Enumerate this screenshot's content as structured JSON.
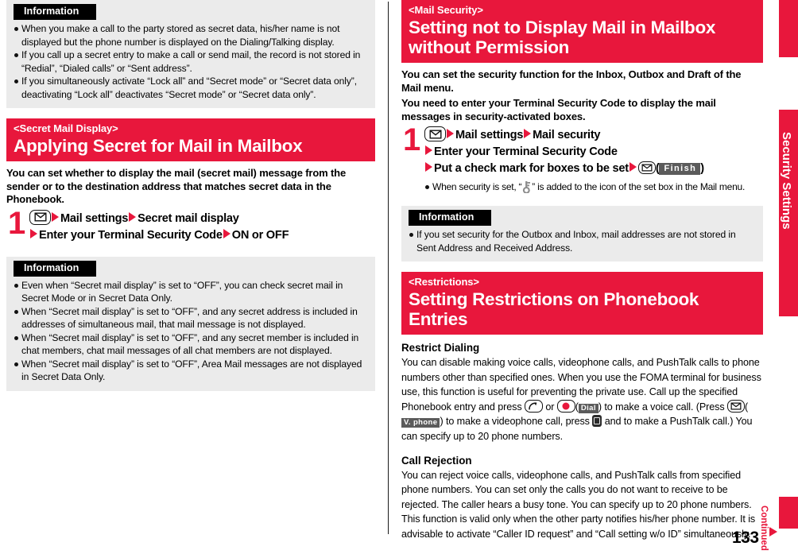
{
  "page": {
    "number": "133",
    "continued_label": "Continued",
    "tab_label": "Security Settings",
    "accent_color": "#e8173c",
    "info_panel_bg": "#ebebeb",
    "softkey_bg": "#5b5b5b"
  },
  "left_column": {
    "info_top": {
      "label": "Information",
      "bullets": [
        "When you make a call to the party stored as secret data, his/her name is not displayed but the phone number is displayed on the Dialing/Talking display.",
        "If you call up a secret entry to make a call or send mail, the record is not stored in “Redial”, “Dialed calls” or “Sent address”.",
        "If you simultaneously activate “Lock all” and “Secret mode” or “Secret data only”, deactivating “Lock all” deactivates “Secret mode” or “Secret data only”."
      ]
    },
    "section": {
      "kicker": "<Secret Mail Display>",
      "title": "Applying Secret for Mail in Mailbox",
      "lead": "You can set whether to display the mail (secret mail) message from the sender or to the destination address that matches secret data in the Phonebook."
    },
    "step": {
      "number": "1",
      "mail_icon": "mail-key-icon",
      "line1_a": "Mail settings",
      "line1_b": "Secret mail display",
      "line2_a": "Enter your Terminal Security Code",
      "line2_b": "ON or OFF"
    },
    "info_bottom": {
      "label": "Information",
      "bullets": [
        "Even when “Secret mail display” is set to “OFF”, you can check secret mail in Secret Mode or in Secret Data Only.",
        "When “Secret mail display” is set to “OFF”, and any secret address is included in addresses of simultaneous mail, that mail message is not displayed.",
        "When “Secret mail display” is set to “OFF”, and any secret member is included in chat members, chat mail messages of all chat members are not displayed.",
        "When “Secret mail display” is set to “OFF”, Area Mail messages are not displayed in Secret Data Only."
      ]
    }
  },
  "right_column": {
    "section_mail_security": {
      "kicker": "<Mail Security>",
      "title": "Setting not to Display Mail in Mailbox without Permission",
      "lead_line1": "You can set the security function for the Inbox, Outbox and Draft of the Mail menu.",
      "lead_line2": "You need to enter your Terminal Security Code to display the mail messages in security-activated boxes."
    },
    "step": {
      "number": "1",
      "mail_icon": "mail-key-icon",
      "line1_a": "Mail settings",
      "line1_b": "Mail security",
      "line2": "Enter your Terminal Security Code",
      "line3": "Put a check mark for boxes to be set",
      "finish_softkey": "Finish",
      "note_before": "When security is set, “",
      "note_icon": "key-icon",
      "note_after": "” is added to the icon of the set box in the Mail menu."
    },
    "info": {
      "label": "Information",
      "bullets": [
        "If you set security for the Outbox and Inbox, mail addresses are not stored in Sent Address and Received Address."
      ]
    },
    "section_restrictions": {
      "kicker": "<Restrictions>",
      "title": "Setting Restrictions on Phonebook Entries"
    },
    "restrict_dialing": {
      "heading": "Restrict Dialing",
      "text_p1": "You can disable making voice calls, videophone calls, and PushTalk calls to phone numbers other than specified ones. When you use the FOMA terminal for business use, this function is useful for preventing the private use. Call up the specified Phonebook entry and press",
      "phone_icon": "phone-key-icon",
      "text_or": "or",
      "circle_icon": "center-key-icon",
      "dial_softkey": "Dial",
      "text_p2": ") to make a voice call. (Press",
      "mail_icon": "mail-key-icon",
      "vphone_softkey": "V. phone",
      "text_p3": ") to make a videophone call, press",
      "pushtalk_icon": "pushtalk-key-icon",
      "text_p4": "and to make a PushTalk call.) You can specify up to 20 phone numbers."
    },
    "call_rejection": {
      "heading": "Call Rejection",
      "text": "You can reject voice calls, videophone calls, and PushTalk calls from specified phone numbers. You can set only the calls you do not want to receive to be rejected. The caller hears a busy tone. You can specify up to 20 phone numbers. This function is valid only when the other party notifies his/her phone number. It is advisable to activate “Caller ID request” and “Call setting w/o ID” simultaneously."
    }
  }
}
